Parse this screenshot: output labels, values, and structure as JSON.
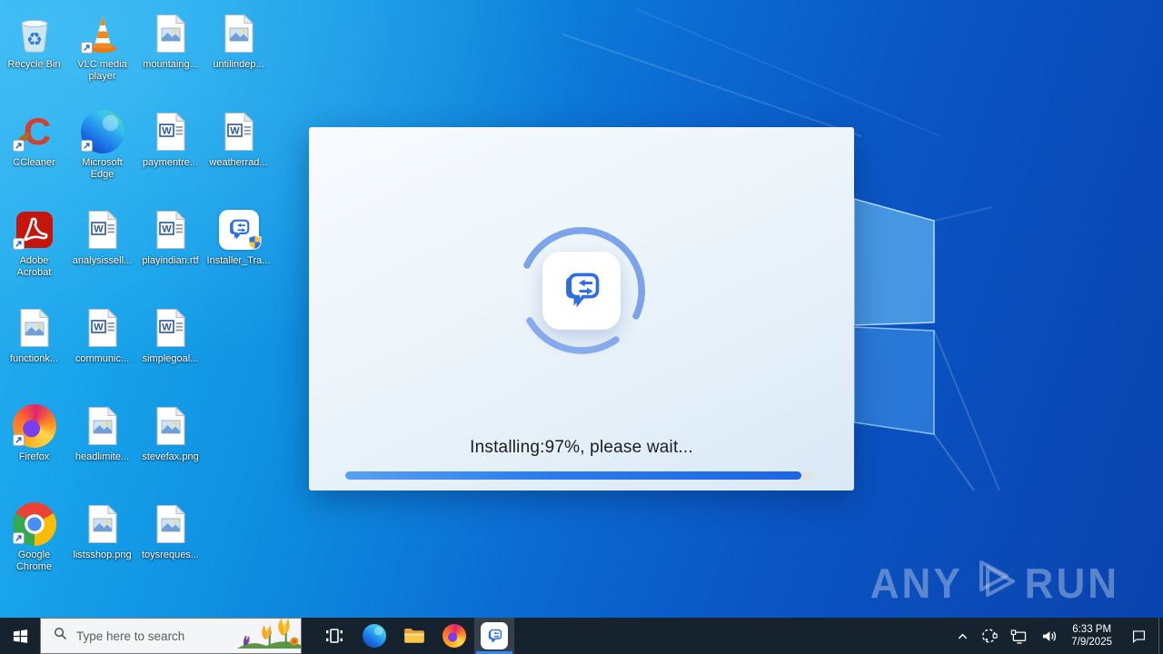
{
  "desktop": {
    "columns": [
      [
        {
          "id": "recycle-bin",
          "label": "Recycle Bin",
          "type": "recycle-bin",
          "overlay": null
        },
        {
          "id": "ccleaner",
          "label": "CCleaner",
          "type": "ccleaner",
          "overlay": "shortcut"
        },
        {
          "id": "adobe-acrobat",
          "label": "Adobe Acrobat",
          "type": "acrobat",
          "overlay": "shortcut"
        },
        {
          "id": "functionk",
          "label": "functionk...",
          "type": "image",
          "overlay": null
        },
        {
          "id": "firefox",
          "label": "Firefox",
          "type": "firefox",
          "overlay": "shortcut"
        },
        {
          "id": "google-chrome",
          "label": "Google Chrome",
          "type": "chrome",
          "overlay": "shortcut"
        }
      ],
      [
        {
          "id": "vlc-media-player",
          "label": "VLC media player",
          "type": "vlc",
          "overlay": "shortcut"
        },
        {
          "id": "microsoft-edge",
          "label": "Microsoft Edge",
          "type": "edge",
          "overlay": "shortcut"
        },
        {
          "id": "analysissell",
          "label": "analysissell...",
          "type": "word",
          "overlay": null
        },
        {
          "id": "communic",
          "label": "communic...",
          "type": "word",
          "overlay": null
        },
        {
          "id": "headlimite",
          "label": "headlimite...",
          "type": "image",
          "overlay": null
        },
        {
          "id": "listsshop",
          "label": "listsshop.png",
          "type": "image",
          "overlay": null
        }
      ],
      [
        {
          "id": "mountaing",
          "label": "mountaing...",
          "type": "image",
          "overlay": null
        },
        {
          "id": "paymentre",
          "label": "paymentre...",
          "type": "word",
          "overlay": null
        },
        {
          "id": "playindian",
          "label": "playindian.rtf",
          "type": "word",
          "overlay": null
        },
        {
          "id": "simplegoal",
          "label": "simplegoal...",
          "type": "word",
          "overlay": null
        },
        {
          "id": "stevefax",
          "label": "stevefax.png",
          "type": "image",
          "overlay": null
        },
        {
          "id": "toysreques",
          "label": "toysreques...",
          "type": "image",
          "overlay": null
        }
      ],
      [
        {
          "id": "untilindep",
          "label": "untilindep...",
          "type": "image",
          "overlay": null
        },
        {
          "id": "weatherrad",
          "label": "weatherrad...",
          "type": "word",
          "overlay": null
        },
        {
          "id": "installer-tra",
          "label": "Installer_Tra...",
          "type": "app",
          "overlay": "shield"
        }
      ]
    ]
  },
  "installer": {
    "status_text": "Installing:97%, please wait...",
    "progress_percent": 97,
    "app_icon": "chat-translate-logo",
    "spinner_color": "#7da3ea",
    "progress_fill_color": "#1d66e6"
  },
  "watermark": {
    "left": "ANY",
    "right": "RUN",
    "logo": "anyrun-play-prism"
  },
  "taskbar": {
    "search": {
      "placeholder": "Type here to search",
      "icon": "magnifier",
      "decoration": "spring-tulips"
    },
    "apps": [
      {
        "id": "task-view",
        "type": "task-view",
        "active": false
      },
      {
        "id": "edge",
        "type": "edge",
        "active": false
      },
      {
        "id": "file-explorer",
        "type": "file-explorer",
        "active": false
      },
      {
        "id": "firefox",
        "type": "firefox",
        "active": false
      },
      {
        "id": "installer",
        "type": "app",
        "active": true
      }
    ],
    "tray": {
      "clock": {
        "time": "6:33 PM",
        "date": "7/9/2025"
      }
    }
  },
  "colors": {
    "taskbar_bg": "#16222e",
    "active_underline": "#3a86f0",
    "wallpaper_top_left": "#2ab1f0",
    "wallpaper_bottom_right": "#0a43ad",
    "app_logo_blue": "#2e6ee0"
  }
}
